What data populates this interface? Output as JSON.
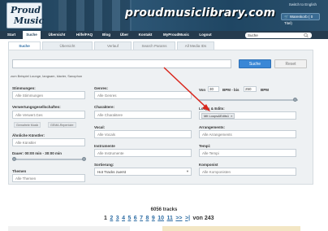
{
  "header": {
    "logo_line1": "Proud",
    "logo_line2": "Music",
    "site_name": "proudmusiclibrary.com",
    "language_link": "Switch to English",
    "cart_label": "Warenkorb ( 0 Titel)"
  },
  "nav": {
    "items": [
      "Start",
      "Suche",
      "Übersicht",
      "Hilfe/FAQ",
      "Blog",
      "Über",
      "Kontakt",
      "MyProudMusic",
      "Logout"
    ],
    "active": "Suche",
    "search_value": "Suche"
  },
  "tabs": {
    "items": [
      "Suche",
      "Übersicht",
      "Verlauf",
      "Search Params",
      "All Media IDs"
    ],
    "active": "Suche"
  },
  "search": {
    "button_label": "Suche",
    "reset_label": "Reset",
    "example": "zum Beispiel Lounge, langsam, klavier, Saxophon"
  },
  "filters": {
    "stimmungen_label": "Stimmungen:",
    "stimmungen_placeholder": "Alle Stimmungen",
    "verwertung_label": "Verwertungsgesellschaften:",
    "verwertung_value": "Alle Verwert.Ges",
    "verwertung_chips": [
      "Gemafreie Musik",
      "GEMA-Repertoire"
    ],
    "kuenstler_label": "Ähnliche Künstler:",
    "kuenstler_placeholder": "Alle Künstler",
    "dauer_label": "Dauer: 00:00 min - 30:00 min",
    "dauer_fill": 1.0,
    "themen_label": "Themen",
    "themen_placeholder": "Alle Themen",
    "genres_label": "Genres:",
    "genres_placeholder": "Alle Genres",
    "charaktere_label": "Charaktere:",
    "charaktere_placeholder": "Alle Charaktere",
    "vocal_label": "Vocal:",
    "vocal_placeholder": "Alle Vocals",
    "instrumente_label": "Instrumente",
    "instrumente_placeholder": "Alle Instrumente",
    "sortierung_label": "Sortierung:",
    "sortierung_value": "Hot Tracks zuerst",
    "bpm_von_label": "Von",
    "bpm_von_value": "30",
    "bpm_bis_label": "BPM - bis",
    "bpm_bis_value": "250",
    "bpm_unit": "BPM",
    "loops_label": "Loops & Edits:",
    "loops_tag": "Mit Loops&Edits1",
    "arrangements_label": "Arrangements:",
    "arrangements_placeholder": "Alle Arrangements",
    "tempi_label": "Tempi:",
    "tempi_placeholder": "Alle Tempi",
    "komponist_label": "Komponist",
    "komponist_placeholder": "Alle Komponisten"
  },
  "results": {
    "count": "6056 tracks",
    "pages": [
      "1",
      "2",
      "3",
      "4",
      "5",
      "6",
      "7",
      "8",
      "9",
      "10",
      "11"
    ],
    "next": ">>",
    "last": ">|",
    "of_text": "von 243"
  },
  "colors": {
    "header_bg": "#1f3f57",
    "nav_bg": "#253b4e",
    "accent_blue": "#3a87d6",
    "link_blue": "#2e6da4",
    "annotation_red": "#d9261c"
  },
  "icons": {
    "search": "magnifier-icon",
    "cart": "cart-icon",
    "dropdown": "chevron-down-icon"
  }
}
